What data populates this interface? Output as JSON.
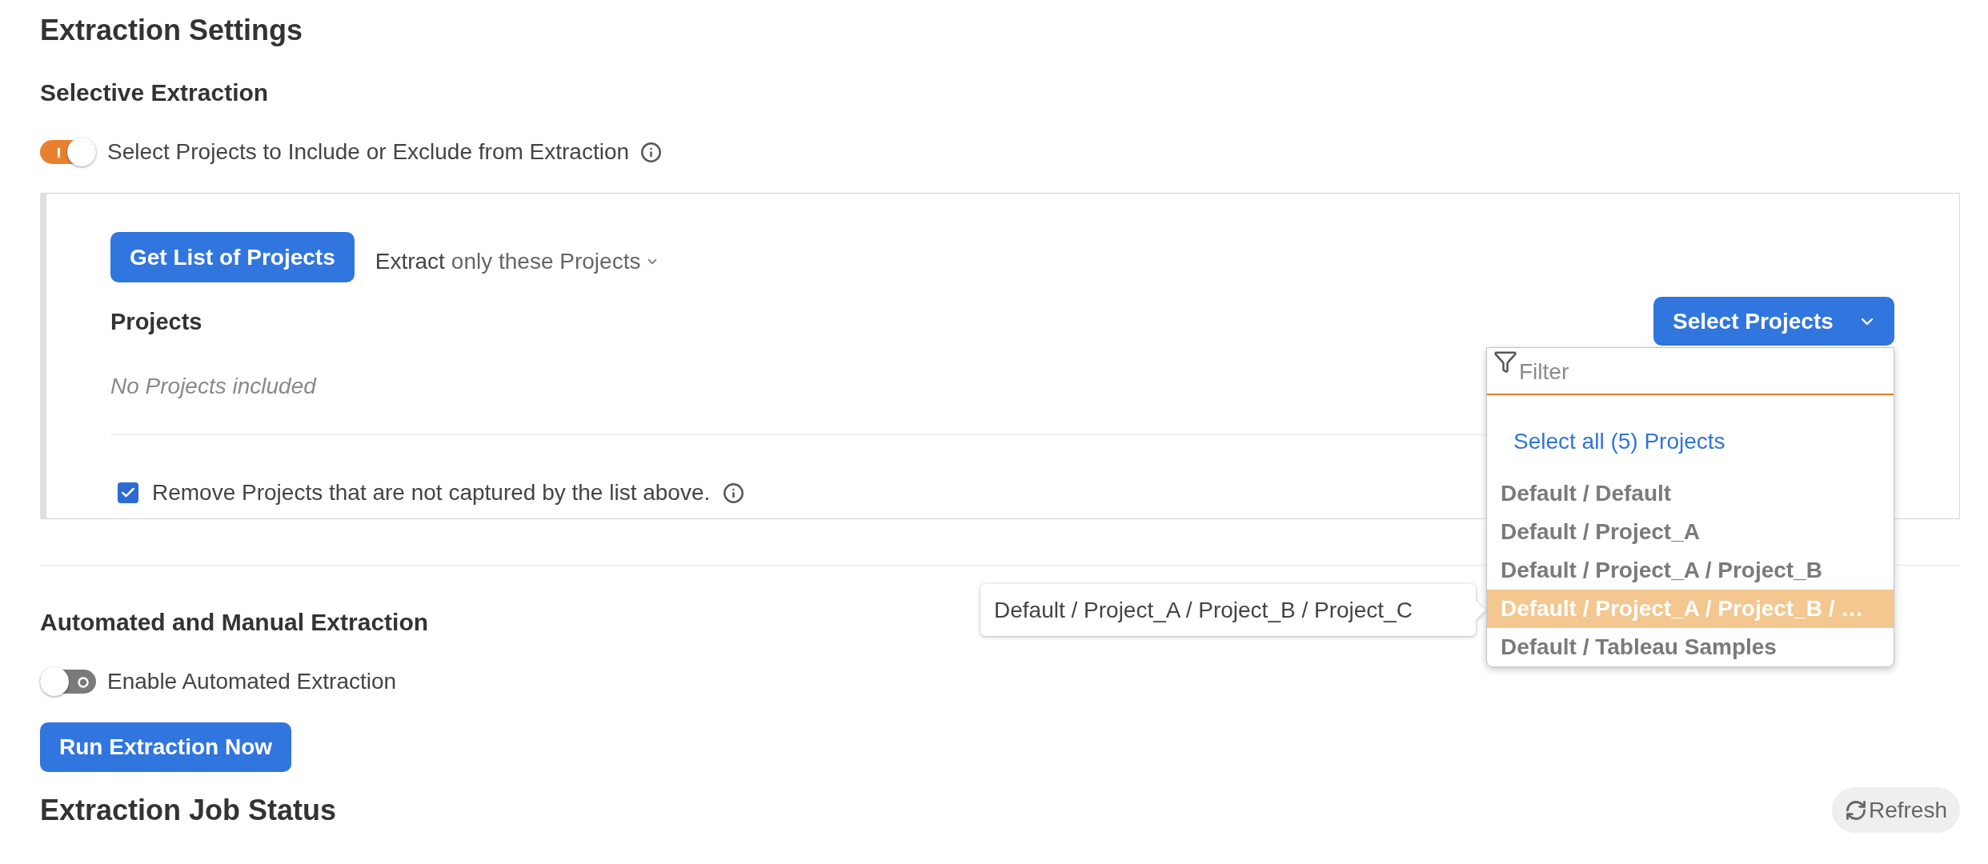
{
  "title": "Extraction Settings",
  "selective_extraction": {
    "heading": "Selective Extraction",
    "toggle": {
      "label": "Select Projects to Include or Exclude from Extraction",
      "on": true
    },
    "panel": {
      "get_list_button": "Get List of Projects",
      "mode_label": "Extract",
      "mode_value": "only these Projects",
      "projects_heading": "Projects",
      "select_button": {
        "label": "Select Projects",
        "expanded": true,
        "dropdown": {
          "filter_placeholder": "Filter",
          "select_all": "Select all (5) Projects",
          "items": [
            {
              "label": "Default / Default",
              "highlighted": false
            },
            {
              "label": "Default / Project_A",
              "highlighted": false
            },
            {
              "label": "Default / Project_A / Project_B",
              "highlighted": false
            },
            {
              "label": "Default / Project_A / Project_B / …",
              "highlighted": true
            },
            {
              "label": "Default / Tableau Samples",
              "highlighted": false
            }
          ],
          "tooltip": "Default / Project_A / Project_B / Project_C"
        }
      },
      "empty_message": "No Projects included",
      "remove_option": {
        "label": "Remove Projects that are not captured by the list above.",
        "checked": true
      }
    }
  },
  "automated_extraction": {
    "heading": "Automated and Manual Extraction",
    "toggle": {
      "label": "Enable Automated Extraction",
      "on": false
    },
    "run_button": "Run Extraction Now"
  },
  "job_status": {
    "heading": "Extraction Job Status",
    "refresh_button": "Refresh"
  }
}
